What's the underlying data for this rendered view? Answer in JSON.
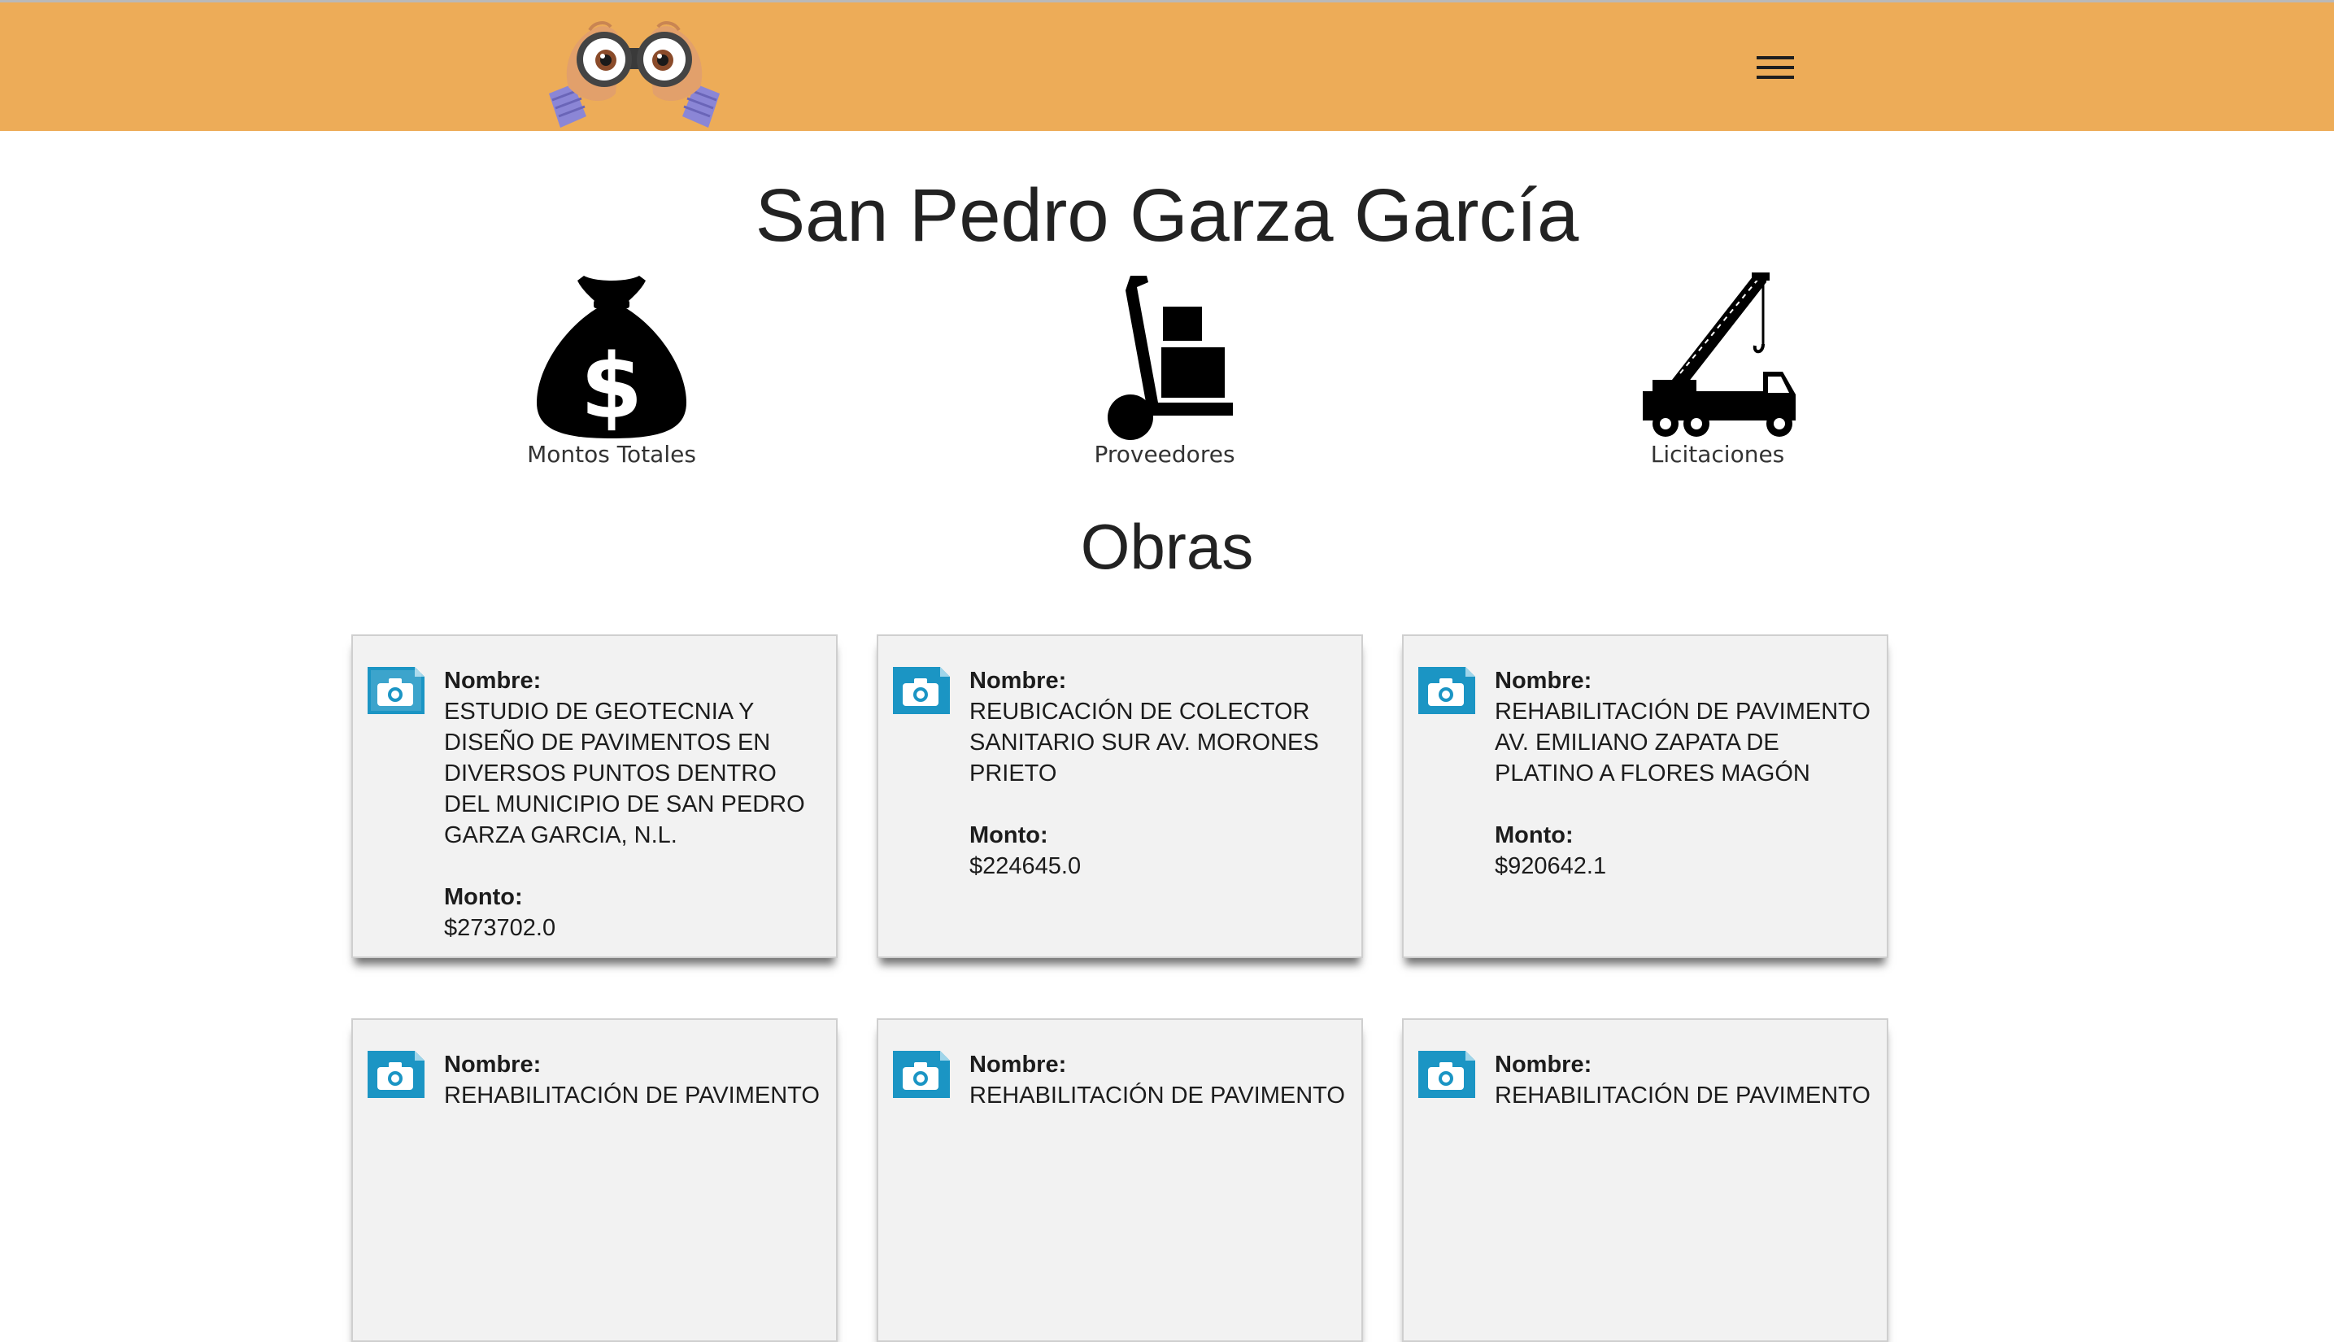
{
  "header": {
    "logo_icon": "binoculars-eyes-icon",
    "menu_icon": "hamburger-menu-icon",
    "background_color": "#edac58"
  },
  "page_title": "San Pedro Garza García",
  "features": [
    {
      "label": "Montos Totales",
      "icon": "money-bag-icon"
    },
    {
      "label": "Proveedores",
      "icon": "hand-truck-icon"
    },
    {
      "label": "Licitaciones",
      "icon": "crane-truck-icon"
    }
  ],
  "section_title": "Obras",
  "cards": [
    {
      "name_label": "Nombre:",
      "name": "ESTUDIO DE GEOTECNIA Y DISEÑO DE PAVIMENTOS EN DIVERSOS PUNTOS DENTRO DEL MUNICIPIO DE SAN PEDRO GARZA GARCIA, N.L.",
      "amount_label": "Monto:",
      "amount": "$273702.0",
      "icon": "camera-image-icon"
    },
    {
      "name_label": "Nombre:",
      "name": "REUBICACIÓN DE COLECTOR SANITARIO SUR AV. MORONES PRIETO",
      "amount_label": "Monto:",
      "amount": "$224645.0",
      "icon": "camera-image-icon"
    },
    {
      "name_label": "Nombre:",
      "name": "REHABILITACIÓN DE PAVIMENTO AV. EMILIANO ZAPATA DE PLATINO A FLORES MAGÓN",
      "amount_label": "Monto:",
      "amount": "$920642.1",
      "icon": "camera-image-icon"
    },
    {
      "name_label": "Nombre:",
      "name": "REHABILITACIÓN DE PAVIMENTO",
      "icon": "camera-image-icon"
    },
    {
      "name_label": "Nombre:",
      "name": "REHABILITACIÓN DE PAVIMENTO",
      "icon": "camera-image-icon"
    },
    {
      "name_label": "Nombre:",
      "name": "REHABILITACIÓN DE PAVIMENTO",
      "icon": "camera-image-icon"
    }
  ]
}
